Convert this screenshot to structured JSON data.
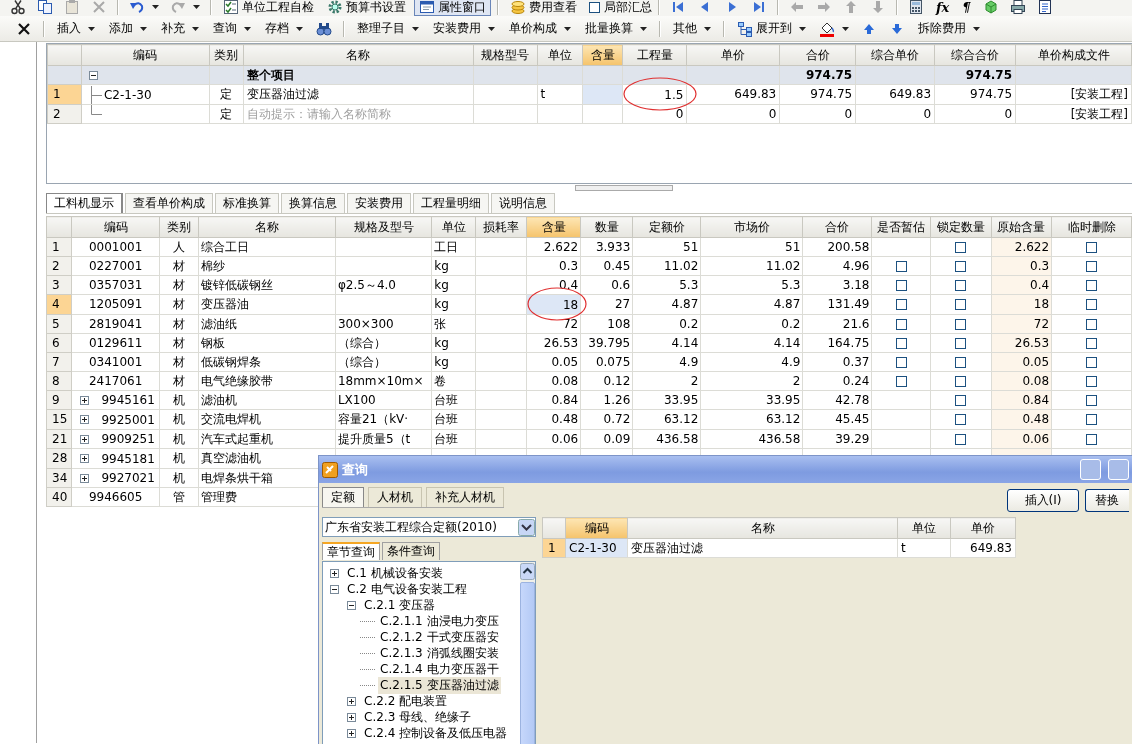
{
  "toolbar": {
    "items": [
      {
        "kind": "icon",
        "disabled": false
      },
      {
        "kind": "icon",
        "disabled": false
      },
      {
        "kind": "icon",
        "disabled": true
      },
      {
        "kind": "icon",
        "disabled": true
      },
      {
        "kind": "separator"
      },
      {
        "kind": "icon",
        "disabled": false,
        "dropdown": true
      },
      {
        "kind": "icon",
        "disabled": true,
        "dropdown": true
      },
      {
        "kind": "separator"
      },
      {
        "kind": "button",
        "label": "单位工程自检",
        "pressed": false
      },
      {
        "kind": "button",
        "label": "预算书设置",
        "pressed": false
      },
      {
        "kind": "button",
        "label": "属性窗口",
        "pressed": true
      },
      {
        "kind": "separator"
      },
      {
        "kind": "button",
        "label": "费用查看",
        "pressed": false
      },
      {
        "kind": "checkbox",
        "label": "局部汇总",
        "checked": false
      },
      {
        "kind": "separator"
      },
      {
        "kind": "icon",
        "disabled": false
      },
      {
        "kind": "icon",
        "disabled": false
      },
      {
        "kind": "icon",
        "disabled": false
      },
      {
        "kind": "icon",
        "disabled": false
      },
      {
        "kind": "separator"
      },
      {
        "kind": "icon",
        "disabled": true
      },
      {
        "kind": "icon",
        "disabled": true
      },
      {
        "kind": "icon",
        "disabled": true
      },
      {
        "kind": "icon",
        "disabled": true
      },
      {
        "kind": "separator"
      },
      {
        "kind": "icon",
        "disabled": false
      },
      {
        "kind": "glyph",
        "text": "fx"
      },
      {
        "kind": "glyph",
        "text": "¶"
      },
      {
        "kind": "icon",
        "disabled": false
      },
      {
        "kind": "icon",
        "disabled": false
      },
      {
        "kind": "icon",
        "disabled": false
      }
    ]
  },
  "command_bar": {
    "items": [
      {
        "kind": "icon",
        "disabled": false
      },
      {
        "kind": "separator"
      },
      {
        "kind": "menu",
        "label": "插入"
      },
      {
        "kind": "menu",
        "label": "添加"
      },
      {
        "kind": "menu",
        "label": "补充"
      },
      {
        "kind": "menu",
        "label": "查询"
      },
      {
        "kind": "menu",
        "label": "存档"
      },
      {
        "kind": "icon",
        "disabled": false
      },
      {
        "kind": "separator"
      },
      {
        "kind": "menu",
        "label": "整理子目"
      },
      {
        "kind": "menu",
        "label": "安装费用"
      },
      {
        "kind": "menu",
        "label": "单价构成"
      },
      {
        "kind": "menu",
        "label": "批量换算"
      },
      {
        "kind": "separator"
      },
      {
        "kind": "menu",
        "label": "其他"
      },
      {
        "kind": "separator"
      },
      {
        "kind": "icon_menu",
        "label": "展开到"
      },
      {
        "kind": "icon",
        "disabled": false,
        "dropdown": true
      },
      {
        "kind": "icon",
        "disabled": false
      },
      {
        "kind": "icon",
        "disabled": false
      },
      {
        "kind": "menu",
        "label": "拆除费用"
      }
    ]
  },
  "upper_table": {
    "columns": [
      {
        "label": "编码",
        "highlighted": false
      },
      {
        "label": "类别",
        "highlighted": false
      },
      {
        "label": "名称",
        "highlighted": false
      },
      {
        "label": "规格型号",
        "highlighted": false
      },
      {
        "label": "单位",
        "highlighted": false
      },
      {
        "label": "含量",
        "highlighted": true
      },
      {
        "label": "工程量",
        "highlighted": false
      },
      {
        "label": "单价",
        "highlighted": false
      },
      {
        "label": "合价",
        "highlighted": false
      },
      {
        "label": "综合单价",
        "highlighted": false
      },
      {
        "label": "综合合价",
        "highlighted": false
      },
      {
        "label": "单价构成文件",
        "highlighted": false
      }
    ],
    "rows": [
      {
        "kind": "group",
        "selected": false,
        "expanded": true,
        "cells": [
          null,
          null,
          "整个项目",
          null,
          null,
          null,
          null,
          null,
          "974.75",
          null,
          "974.75",
          null
        ]
      },
      {
        "kind": "item",
        "num": "1",
        "selected": true,
        "cells": [
          "C2-1-30",
          "定",
          "变压器油过滤",
          null,
          "t",
          null,
          {
            "text": "1.5",
            "annotated": true
          },
          "649.83",
          "974.75",
          "649.83",
          "974.75",
          "[安装工程]"
        ]
      },
      {
        "kind": "item",
        "num": "2",
        "selected": false,
        "cells": [
          null,
          "定",
          {
            "placeholder": "自动提示：请输入名称简称"
          },
          null,
          null,
          null,
          "0",
          "0",
          "0",
          "0",
          "0",
          "[安装工程]"
        ]
      }
    ]
  },
  "lower_tabs": [
    {
      "label": "工料机显示",
      "selected": true
    },
    {
      "label": "查看单价构成",
      "selected": false
    },
    {
      "label": "标准换算",
      "selected": false
    },
    {
      "label": "换算信息",
      "selected": false
    },
    {
      "label": "安装费用",
      "selected": false
    },
    {
      "label": "工程量明细",
      "selected": false
    },
    {
      "label": "说明信息",
      "selected": false
    }
  ],
  "lower_table": {
    "columns": [
      {
        "label": "编码",
        "highlighted": false
      },
      {
        "label": "类别",
        "highlighted": false
      },
      {
        "label": "名称",
        "highlighted": false
      },
      {
        "label": "规格及型号",
        "highlighted": false
      },
      {
        "label": "单位",
        "highlighted": false
      },
      {
        "label": "损耗率",
        "highlighted": false
      },
      {
        "label": "含量",
        "highlighted": true
      },
      {
        "label": "数量",
        "highlighted": false
      },
      {
        "label": "定额价",
        "highlighted": false
      },
      {
        "label": "市场价",
        "highlighted": false
      },
      {
        "label": "合价",
        "highlighted": false
      },
      {
        "label": "是否暂估",
        "highlighted": false
      },
      {
        "label": "锁定数量",
        "highlighted": false
      },
      {
        "label": "原始含量",
        "highlighted": false
      },
      {
        "label": "临时删除",
        "highlighted": false
      }
    ],
    "rows": [
      {
        "num": "1",
        "selected": false,
        "cells": [
          "0001001",
          "人",
          "综合工日",
          null,
          "工日",
          null,
          "2.622",
          "3.933",
          "51",
          "51",
          "200.58",
          null,
          {
            "checked": false
          },
          "2.622",
          {
            "checked": false
          }
        ]
      },
      {
        "num": "2",
        "selected": false,
        "cells": [
          "0227001",
          "材",
          "棉纱",
          null,
          "kg",
          null,
          "0.3",
          "0.45",
          "11.02",
          "11.02",
          "4.96",
          {
            "checked": false
          },
          {
            "checked": false
          },
          "0.3",
          {
            "checked": false
          }
        ]
      },
      {
        "num": "3",
        "selected": false,
        "cells": [
          "0357031",
          "材",
          "镀锌低碳钢丝",
          "φ2.5～4.0",
          "kg",
          null,
          "0.4",
          "0.6",
          "5.3",
          "5.3",
          "3.18",
          {
            "checked": false
          },
          {
            "checked": false
          },
          "0.4",
          {
            "checked": false
          }
        ]
      },
      {
        "num": "4",
        "selected": true,
        "cells": [
          "1205091",
          "材",
          "变压器油",
          null,
          "kg",
          null,
          {
            "text": "18",
            "annotated": true
          },
          "27",
          "4.87",
          "4.87",
          "131.49",
          {
            "checked": false
          },
          {
            "checked": false
          },
          "18",
          {
            "checked": false
          }
        ]
      },
      {
        "num": "5",
        "selected": false,
        "cells": [
          "2819041",
          "材",
          "滤油纸",
          "300×300",
          "张",
          null,
          "72",
          "108",
          "0.2",
          "0.2",
          "21.6",
          {
            "checked": false
          },
          {
            "checked": false
          },
          "72",
          {
            "checked": false
          }
        ]
      },
      {
        "num": "6",
        "selected": false,
        "cells": [
          "0129611",
          "材",
          "钢板",
          "（综合）",
          "kg",
          null,
          "26.53",
          "39.795",
          "4.14",
          "4.14",
          "164.75",
          {
            "checked": false
          },
          {
            "checked": false
          },
          "26.53",
          {
            "checked": false
          }
        ]
      },
      {
        "num": "7",
        "selected": false,
        "cells": [
          "0341001",
          "材",
          "低碳钢焊条",
          "（综合）",
          "kg",
          null,
          "0.05",
          "0.075",
          "4.9",
          "4.9",
          "0.37",
          {
            "checked": false
          },
          {
            "checked": false
          },
          "0.05",
          {
            "checked": false
          }
        ]
      },
      {
        "num": "8",
        "selected": false,
        "cells": [
          "2417061",
          "材",
          "电气绝缘胶带",
          "18mm×10m×",
          "卷",
          null,
          "0.08",
          "0.12",
          "2",
          "2",
          "0.24",
          {
            "checked": false
          },
          {
            "checked": false
          },
          "0.08",
          {
            "checked": false
          }
        ]
      },
      {
        "num": "9",
        "selected": false,
        "expanded": false,
        "cells": [
          "9945161",
          "机",
          "滤油机",
          "LX100",
          "台班",
          null,
          "0.84",
          "1.26",
          "33.95",
          "33.95",
          "42.78",
          null,
          {
            "checked": false
          },
          "0.84",
          {
            "checked": false
          }
        ]
      },
      {
        "num": "15",
        "selected": false,
        "expanded": false,
        "cells": [
          "9925001",
          "机",
          "交流电焊机",
          "容量21（kV·",
          "台班",
          null,
          "0.48",
          "0.72",
          "63.12",
          "63.12",
          "45.45",
          null,
          {
            "checked": false
          },
          "0.48",
          {
            "checked": false
          }
        ]
      },
      {
        "num": "21",
        "selected": false,
        "expanded": false,
        "cells": [
          "9909251",
          "机",
          "汽车式起重机",
          "提升质量5（t",
          "台班",
          null,
          "0.06",
          "0.09",
          "436.58",
          "436.58",
          "39.29",
          null,
          {
            "checked": false
          },
          "0.06",
          {
            "checked": false
          }
        ]
      },
      {
        "num": "28",
        "selected": false,
        "expanded": false,
        "cells": [
          "9945181",
          "机",
          "真空滤油机",
          null,
          null,
          null,
          null,
          null,
          null,
          null,
          null,
          null,
          null,
          null,
          null
        ]
      },
      {
        "num": "34",
        "selected": false,
        "expanded": false,
        "cells": [
          "9927021",
          "机",
          "电焊条烘干箱",
          null,
          null,
          null,
          null,
          null,
          null,
          null,
          null,
          null,
          null,
          null,
          null
        ]
      },
      {
        "num": "40",
        "selected": false,
        "cells": [
          "9946605",
          "管",
          "管理费",
          null,
          null,
          null,
          null,
          null,
          null,
          null,
          null,
          null,
          null,
          null,
          null
        ]
      }
    ]
  },
  "dialog": {
    "title": "查询",
    "tabs": [
      {
        "label": "定额",
        "selected": true
      },
      {
        "label": "人材机",
        "selected": false
      },
      {
        "label": "补充人材机",
        "selected": false
      }
    ],
    "buttons": [
      "插入(I)",
      "替换"
    ],
    "library_select": {
      "value": "广东省安装工程综合定额(2010)"
    },
    "subtabs": [
      {
        "label": "章节查询",
        "selected": true
      },
      {
        "label": "条件查询",
        "selected": false
      }
    ],
    "tree": [
      {
        "label": "C.1 机械设备安装",
        "expanded": false,
        "selected": false
      },
      {
        "label": "C.2 电气设备安装工程",
        "expanded": true,
        "selected": false,
        "children": [
          {
            "label": "C.2.1 变压器",
            "expanded": true,
            "selected": false,
            "children": [
              {
                "label": "C.2.1.1 油浸电力变压",
                "selected": false
              },
              {
                "label": "C.2.1.2 干式变压器安",
                "selected": false
              },
              {
                "label": "C.2.1.3 消弧线圈安装",
                "selected": false
              },
              {
                "label": "C.2.1.4 电力变压器干",
                "selected": false
              },
              {
                "label": "C.2.1.5 变压器油过滤",
                "selected": true
              }
            ]
          },
          {
            "label": "C.2.2 配电装置",
            "expanded": false,
            "selected": false
          },
          {
            "label": "C.2.3 母线、绝缘子",
            "expanded": false,
            "selected": false
          },
          {
            "label": "C.2.4 控制设备及低压电器",
            "expanded": false,
            "selected": false
          }
        ]
      }
    ],
    "results": {
      "columns": [
        {
          "label": "编码",
          "highlighted": true
        },
        {
          "label": "名称",
          "highlighted": false
        },
        {
          "label": "单位",
          "highlighted": false
        },
        {
          "label": "单价",
          "highlighted": false
        }
      ],
      "rows": [
        {
          "num": "1",
          "selected": true,
          "cells": [
            "C2-1-30",
            "变压器油过滤",
            "t",
            "649.83"
          ]
        }
      ]
    }
  }
}
